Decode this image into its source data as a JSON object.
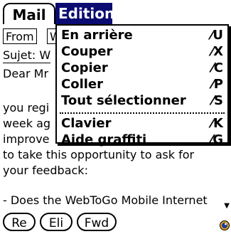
{
  "menubar": {
    "mail": "Mail",
    "edition": "Edition"
  },
  "fields": {
    "from_label": "From",
    "cut_w": "W",
    "subject": "Sujet: W"
  },
  "body": {
    "l1": "Dear Mr",
    "l2": "you regi",
    "l3": "week ag",
    "l4": "improve",
    "l5": "to take this opportunity to ask for",
    "l6": "your feedback:",
    "l7": "- Does the WebToGo Mobile Internet"
  },
  "menu": {
    "items": [
      {
        "label": "En arrière",
        "shortcut": "⁄U"
      },
      {
        "label": "Couper",
        "shortcut": "⁄X"
      },
      {
        "label": "Copier",
        "shortcut": "⁄C"
      },
      {
        "label": "Coller",
        "shortcut": "⁄P"
      },
      {
        "label": "Tout sélectionner",
        "shortcut": "⁄S"
      },
      {
        "label": "Clavier",
        "shortcut": "⁄K"
      },
      {
        "label": "Aide graffiti",
        "shortcut": "⁄G"
      }
    ]
  },
  "buttons": {
    "re": "Re",
    "eli": "Eli",
    "fwd": "Fwd"
  },
  "colors": {
    "menu_highlight": "#0b0b72",
    "icon_orange": "#e7a11b",
    "icon_blue": "#1a3c9c"
  }
}
